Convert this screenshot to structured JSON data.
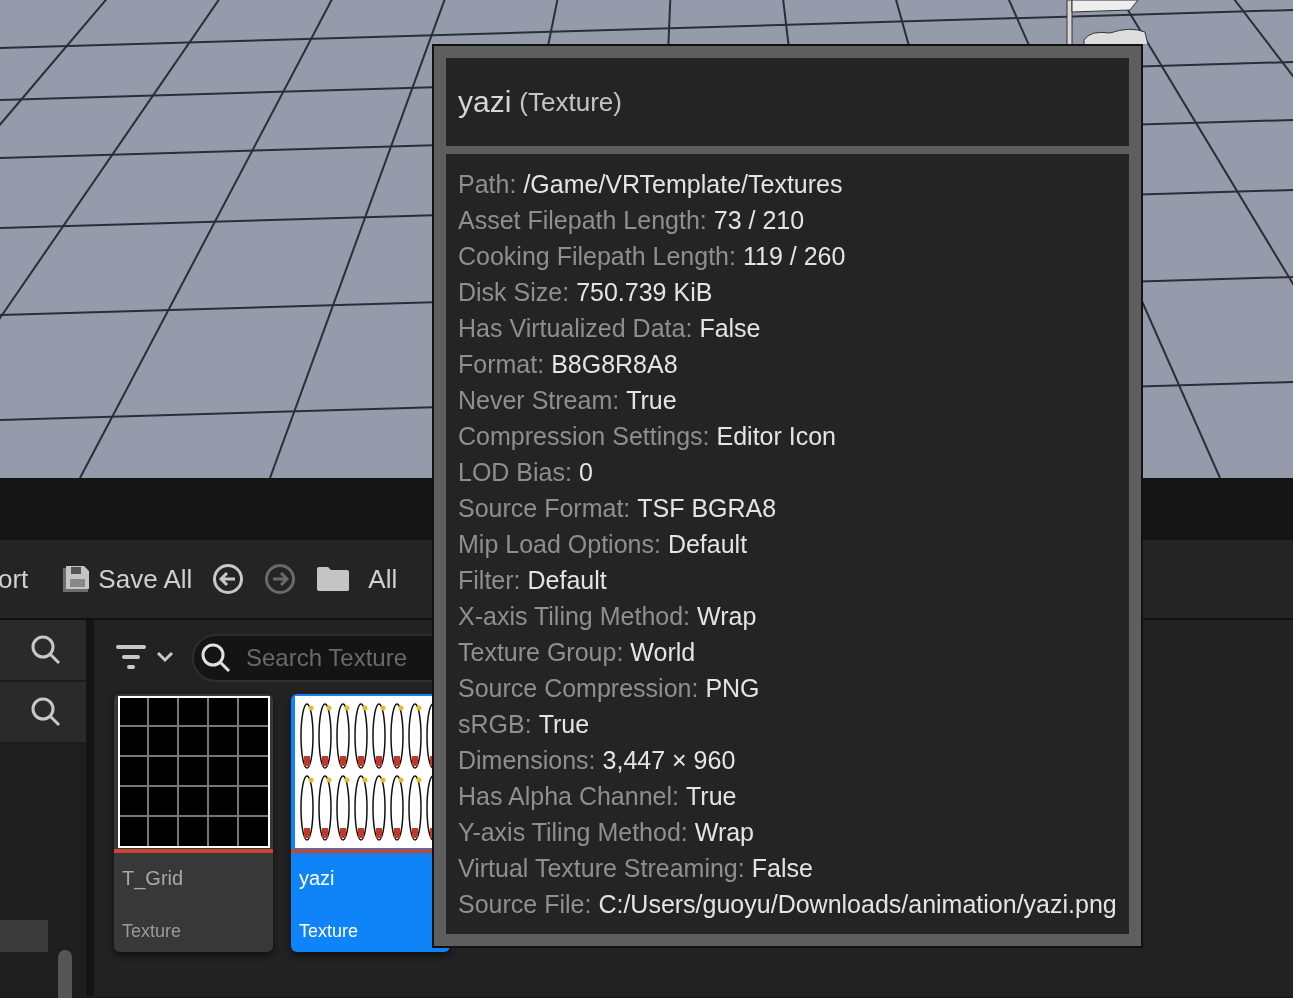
{
  "toolbar": {
    "items": [
      {
        "kind": "text",
        "label": "ort"
      },
      {
        "kind": "save",
        "label": "Save All"
      },
      {
        "kind": "back",
        "disabled": false
      },
      {
        "kind": "forward",
        "disabled": true
      },
      {
        "kind": "folder",
        "label": "All"
      }
    ]
  },
  "search": {
    "placeholder": "Search Texture"
  },
  "assets": [
    {
      "kind": "grid",
      "name": "T_Grid",
      "type": "Texture",
      "selected": false
    },
    {
      "kind": "sprites",
      "name": "yazi",
      "type": "Texture",
      "selected": true
    }
  ],
  "tooltip": {
    "title": "yazi",
    "subtitle": "(Texture)",
    "rows": [
      {
        "label": "Path:",
        "value": "/Game/VRTemplate/Textures"
      },
      {
        "label": "Asset Filepath Length:",
        "value": "73 / 210"
      },
      {
        "label": "Cooking Filepath Length:",
        "value": "119 / 260"
      },
      {
        "label": "Disk Size:",
        "value": "750.739 KiB"
      },
      {
        "label": "Has Virtualized Data:",
        "value": "False"
      },
      {
        "label": "Format:",
        "value": "B8G8R8A8"
      },
      {
        "label": "Never Stream:",
        "value": "True"
      },
      {
        "label": "Compression Settings:",
        "value": "Editor Icon"
      },
      {
        "label": "LOD Bias:",
        "value": "0"
      },
      {
        "label": "Source Format:",
        "value": "TSF BGRA8"
      },
      {
        "label": "Mip Load Options:",
        "value": "Default"
      },
      {
        "label": "Filter:",
        "value": "Default"
      },
      {
        "label": "X-axis Tiling Method:",
        "value": "Wrap"
      },
      {
        "label": "Texture Group:",
        "value": "World"
      },
      {
        "label": "Source Compression:",
        "value": "PNG"
      },
      {
        "label": "sRGB:",
        "value": "True"
      },
      {
        "label": "Dimensions:",
        "value": "3,447 × 960"
      },
      {
        "label": "Has Alpha Channel:",
        "value": "True"
      },
      {
        "label": "Y-axis Tiling Method:",
        "value": "Wrap"
      },
      {
        "label": "Virtual Texture Streaming:",
        "value": "False"
      },
      {
        "label": "Source File:",
        "value": "C:/Users/guoyu/Downloads/animation/yazi.png"
      }
    ]
  }
}
